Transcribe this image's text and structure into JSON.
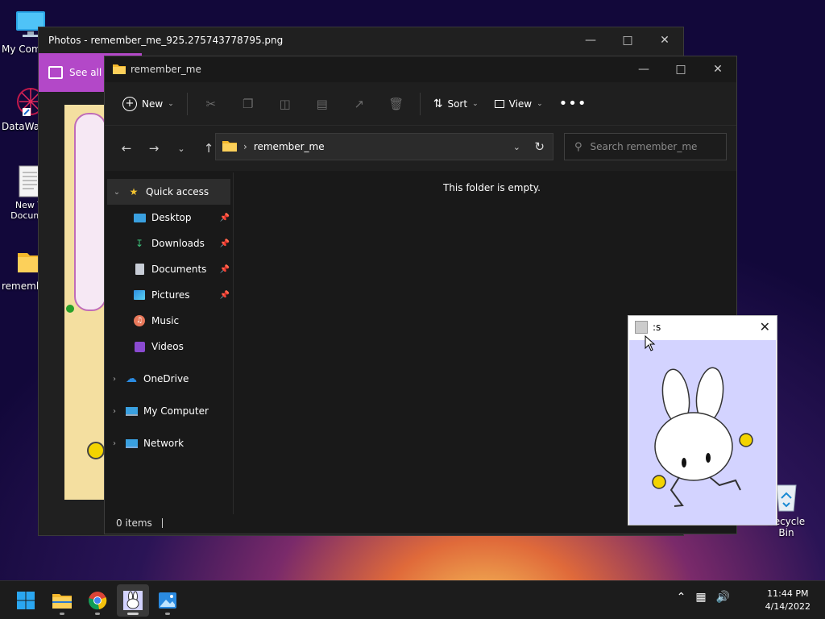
{
  "desktop": {
    "icons": [
      {
        "label": "My Com"
      },
      {
        "label": "DataWag"
      },
      {
        "label": "New T Docume"
      },
      {
        "label": "rememb"
      }
    ],
    "recycle_label": "Recycle Bin"
  },
  "photos": {
    "title": "Photos - remember_me_925.275743778795.png",
    "see_all": "See all p"
  },
  "explorer": {
    "title": "remember_me",
    "toolbar": {
      "new_label": "New",
      "sort_label": "Sort",
      "view_label": "View"
    },
    "address": {
      "path": "remember_me"
    },
    "search": {
      "placeholder": "Search remember_me"
    },
    "sidebar": {
      "quick_access": "Quick access",
      "items": [
        {
          "label": "Desktop"
        },
        {
          "label": "Downloads"
        },
        {
          "label": "Documents"
        },
        {
          "label": "Pictures"
        },
        {
          "label": "Music"
        },
        {
          "label": "Videos"
        }
      ],
      "onedrive": "OneDrive",
      "my_computer": "My Computer",
      "network": "Network"
    },
    "empty_message": "This folder is empty.",
    "status": "0 items"
  },
  "viewer": {
    "title": ":s"
  },
  "taskbar": {
    "time": "11:44 PM",
    "date": "4/14/2022"
  },
  "colors": {
    "accent": "#0078d4",
    "photos_purple": "#b348c8",
    "viewer_bg": "#d3d3ff"
  }
}
